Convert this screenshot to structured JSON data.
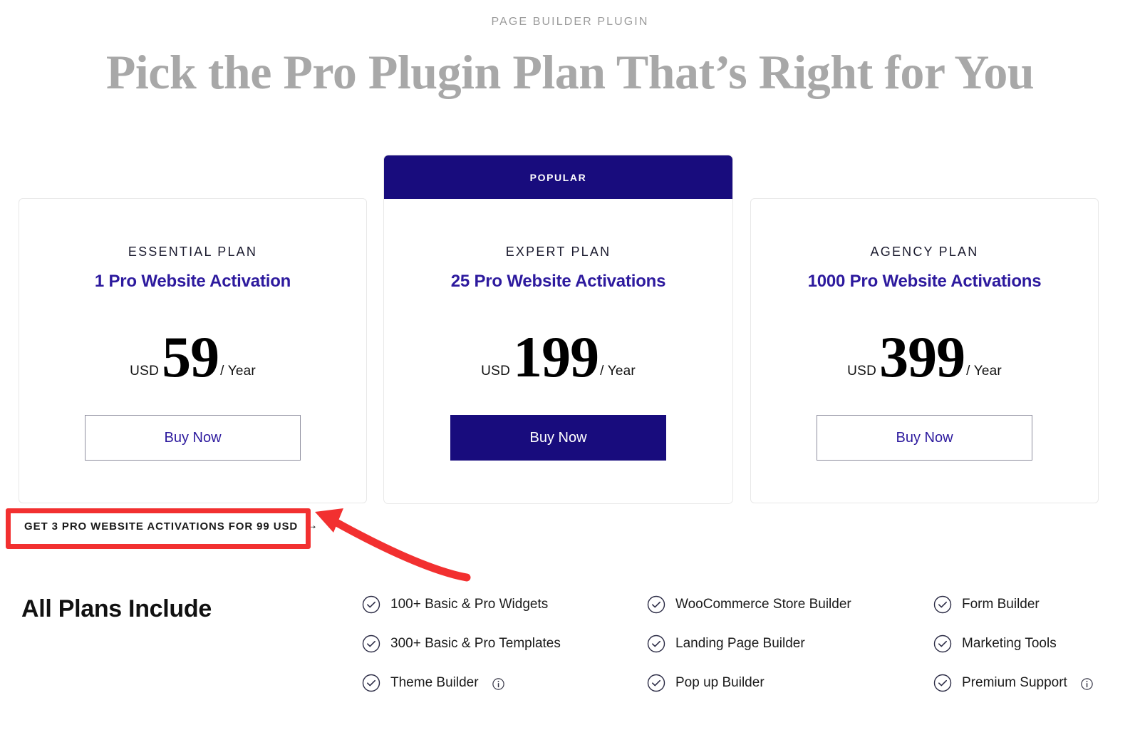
{
  "header": {
    "eyebrow": "PAGE BUILDER PLUGIN",
    "headline": "Pick the Pro Plugin Plan That’s Right for You"
  },
  "colors": {
    "brand_indigo": "#180c7d",
    "accent_blue": "#2d1a9e",
    "annotation_red": "#f23030",
    "headline_gray": "#a8a8a8",
    "eyebrow_gray": "#9b9b9b"
  },
  "plans": [
    {
      "badge": "",
      "name": "ESSENTIAL PLAN",
      "activations": "1 Pro Website Activation",
      "currency": "USD",
      "amount": "59",
      "period": "/ Year",
      "cta": "Buy Now",
      "highlighted": false
    },
    {
      "badge": "POPULAR",
      "name": "EXPERT PLAN",
      "activations": "25 Pro Website Activations",
      "currency": "USD",
      "amount": "199",
      "period": "/ Year",
      "cta": "Buy Now",
      "highlighted": true
    },
    {
      "badge": "",
      "name": "AGENCY PLAN",
      "activations": "1000 Pro Website Activations",
      "currency": "USD",
      "amount": "399",
      "period": "/ Year",
      "cta": "Buy Now",
      "highlighted": false
    }
  ],
  "promo": {
    "label": "GET 3 PRO WEBSITE ACTIVATIONS FOR 99 USD",
    "arrow_glyph": "→"
  },
  "annotation": {
    "shape": "red-rectangle-and-curved-arrow",
    "target": "promo-link"
  },
  "features": {
    "title": "All Plans Include",
    "columns": [
      [
        {
          "label": "100+ Basic & Pro Widgets",
          "info": false
        },
        {
          "label": "300+ Basic & Pro Templates",
          "info": false
        },
        {
          "label": "Theme Builder",
          "info": true
        }
      ],
      [
        {
          "label": "WooCommerce Store Builder",
          "info": false
        },
        {
          "label": "Landing Page Builder",
          "info": false
        },
        {
          "label": "Pop up Builder",
          "info": false
        }
      ],
      [
        {
          "label": "Form Builder",
          "info": false
        },
        {
          "label": "Marketing Tools",
          "info": false
        },
        {
          "label": "Premium Support",
          "info": true
        }
      ]
    ]
  }
}
